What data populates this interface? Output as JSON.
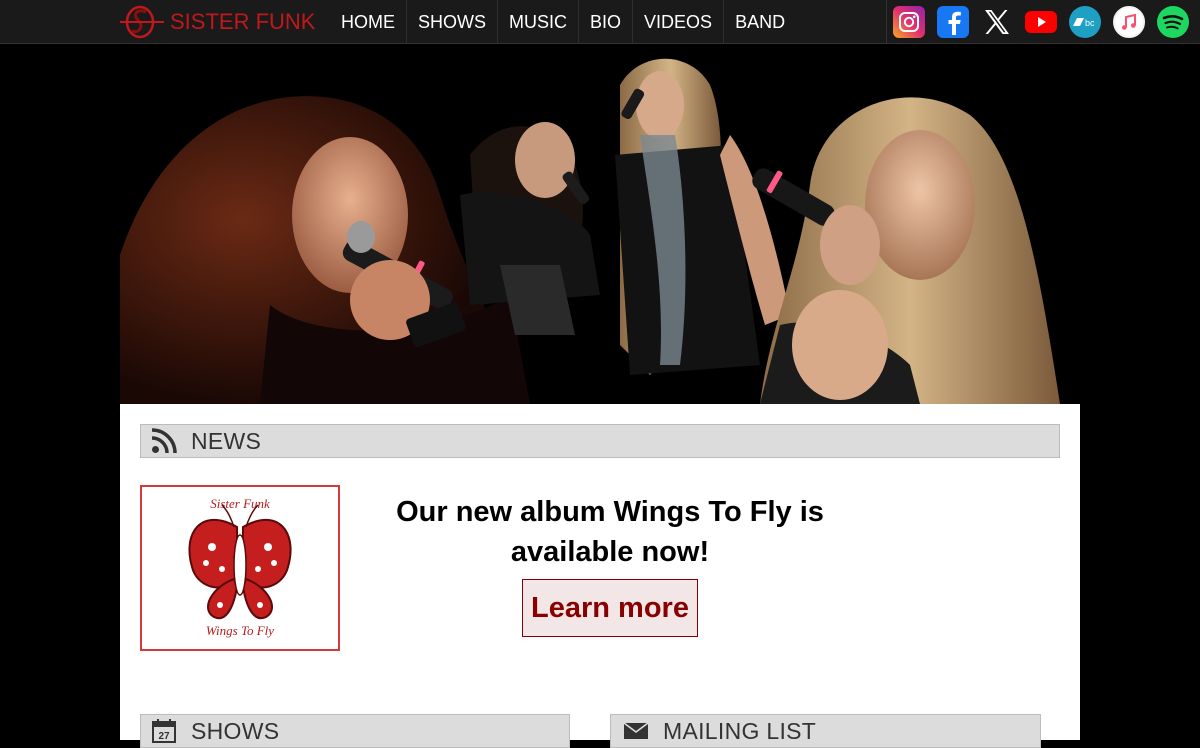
{
  "brand": {
    "name": "SISTER FUNK",
    "accent": "#c0181c"
  },
  "nav": {
    "items": [
      "HOME",
      "SHOWS",
      "MUSIC",
      "BIO",
      "VIDEOS",
      "BAND"
    ]
  },
  "social": [
    "instagram-icon",
    "facebook-icon",
    "x-icon",
    "youtube-icon",
    "bandcamp-icon",
    "apple-music-icon",
    "spotify-icon"
  ],
  "news": {
    "title": "NEWS",
    "album_cover": {
      "top_text": "Sister Funk",
      "bottom_text": "Wings To Fly"
    },
    "headline": "Our new album Wings To Fly is available now!",
    "button": "Learn more"
  },
  "shows": {
    "title": "SHOWS",
    "calendar_day": "27"
  },
  "mailing": {
    "title": "MAILING LIST"
  }
}
